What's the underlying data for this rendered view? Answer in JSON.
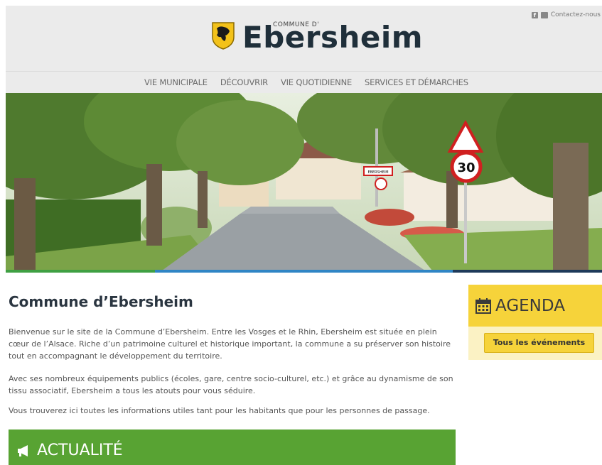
{
  "header": {
    "contact_label": "Contactez-nous",
    "logo_small": "COMMUNE D'",
    "logo_big": "Ebersheim"
  },
  "nav": {
    "items": [
      {
        "label": "VIE MUNICIPALE"
      },
      {
        "label": "DÉCOUVRIR"
      },
      {
        "label": "VIE QUOTIDIENNE"
      },
      {
        "label": "SERVICES ET DÉMARCHES"
      }
    ],
    "accent_colors": [
      "#3fa043",
      "#2f85c5",
      "#1e3a5a",
      "#2f85c5"
    ]
  },
  "hero": {
    "sign_speed": "30",
    "sign_town": "EBERSHEIM"
  },
  "main": {
    "title": "Commune d’Ebersheim",
    "paragraphs": [
      "Bienvenue sur le site de la Commune d’Ebersheim. Entre les Vosges et le Rhin, Ebersheim est située en plein cœur de l’Alsace. Riche d’un patrimoine culturel et historique important, la commune a su préserver son histoire tout en accompagnant le développement du territoire.",
      "Avec ses nombreux équipements publics (écoles, gare, centre socio-culturel, etc.) et grâce au dynamisme de son tissu associatif, Ebersheim a tous les atouts pour vous séduire.",
      "Vous trouverez ici toutes les informations utiles tant pour les habitants que pour les personnes de passage."
    ],
    "actualite_label": "ACTUALITÉ"
  },
  "agenda": {
    "title": "AGENDA",
    "button_label": "Tous les événements"
  },
  "colors": {
    "accent_green": "#58a333",
    "agenda_yellow": "#f6d33a",
    "title_dark": "#2a3540"
  },
  "icons": [
    "facebook-icon",
    "mail-icon",
    "shield-logo-icon",
    "megaphone-icon",
    "calendar-icon"
  ]
}
